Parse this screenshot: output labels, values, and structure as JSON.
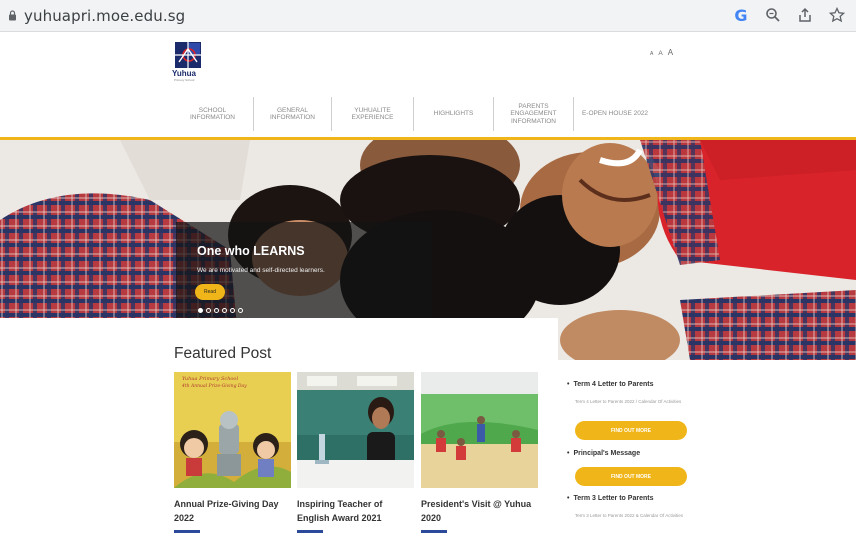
{
  "browser": {
    "url": "yuhuapri.moe.edu.sg",
    "icons": [
      "lock-icon",
      "google-icon",
      "zoom-icon",
      "share-icon",
      "bookmark-star-icon"
    ],
    "google_label": "G"
  },
  "header": {
    "logo_text": "Yuhua",
    "logo_sub": "Primary School",
    "font_sizes": [
      "A",
      "A",
      "A"
    ],
    "nav": [
      "SCHOOL INFORMATION",
      "GENERAL INFORMATION",
      "YUHUALITE EXPERIENCE",
      "HIGHLIGHTS",
      "PARENTS ENGAGEMENT INFORMATION",
      "E-OPEN HOUSE 2022"
    ]
  },
  "hero": {
    "title": "One who LEARNS",
    "body": "We are motivated and self-directed learners.",
    "button": "Read",
    "slide_count": 6,
    "active_slide": 1
  },
  "featured": {
    "heading": "Featured Post",
    "posts": [
      {
        "title": "Annual Prize-Giving Day 2022",
        "image_text_line1": "Yuhua Primary School",
        "image_text_line2": "4th Annual Prize-Giving Day"
      },
      {
        "title": "Inspiring Teacher of English Award 2021"
      },
      {
        "title": "President's Visit @ Yuhua 2020"
      }
    ]
  },
  "sidebar": {
    "items": [
      {
        "title": "Term 4 Letter to Parents",
        "sub": "Term 4 Letter to Parents 2022 / Calendar Of Activities",
        "button": "FIND OUT MORE"
      },
      {
        "title": "Principal's Message",
        "sub": "",
        "button": "FIND OUT MORE"
      },
      {
        "title": "Term 3 Letter to Parents",
        "sub": "Term 3 Letter to Parents 2022 & Calendar Of Activities",
        "button": ""
      }
    ]
  },
  "colors": {
    "accent": "#f0b619",
    "brand_blue": "#1b2a6b",
    "card_bar": "#2b4a9a"
  }
}
